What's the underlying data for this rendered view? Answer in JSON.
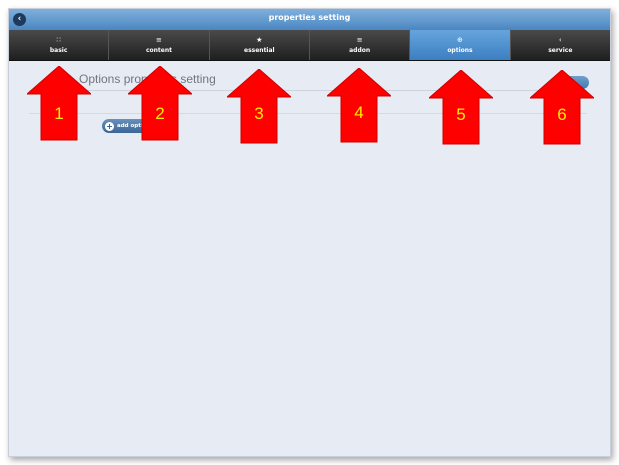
{
  "window": {
    "title": "properties setting"
  },
  "tabs": [
    {
      "label": "basic",
      "icon": "grid-icon",
      "glyph": "∷"
    },
    {
      "label": "content",
      "icon": "list-icon",
      "glyph": "≡"
    },
    {
      "label": "essential",
      "icon": "star-icon",
      "glyph": "★"
    },
    {
      "label": "addon",
      "icon": "list-icon",
      "glyph": "≡"
    },
    {
      "label": "options",
      "icon": "plus-circle-icon",
      "glyph": "⊕",
      "active": true
    },
    {
      "label": "service",
      "icon": "chevron-left-icon",
      "glyph": "‹"
    }
  ],
  "content": {
    "section_title": "Options properties setting",
    "add_button": "add options"
  },
  "annotations": [
    "1",
    "2",
    "3",
    "4",
    "5",
    "6"
  ],
  "colors": {
    "arrow_fill": "#ff0000",
    "arrow_text": "#ffee00",
    "active_tab": "#4b8fd0"
  }
}
